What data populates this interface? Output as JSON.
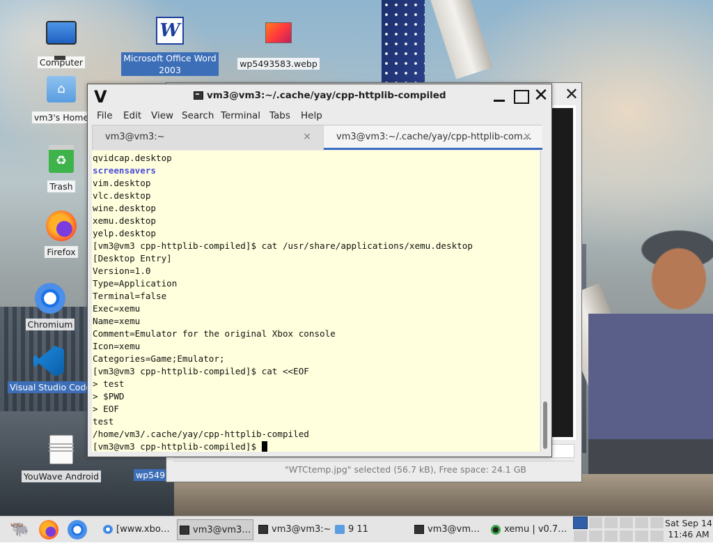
{
  "desktop": {
    "icons": [
      {
        "label": "Computer",
        "icon": "computer-icon"
      },
      {
        "label": "vm3's Home",
        "icon": "home-folder-icon"
      },
      {
        "label": "Trash",
        "icon": "trash-icon"
      },
      {
        "label": "Firefox",
        "icon": "firefox-icon"
      },
      {
        "label": "Chromium",
        "icon": "chromium-icon"
      },
      {
        "label": "Visual Studio Code",
        "icon": "vscode-icon"
      },
      {
        "label": "YouWave Android",
        "icon": "document-icon"
      },
      {
        "label": "Microsoft Office Word 2003",
        "icon": "word-icon"
      },
      {
        "label": "wp5493583.webp",
        "icon": "image-icon"
      },
      {
        "label": "wp549",
        "icon": "image-icon"
      }
    ]
  },
  "file_manager": {
    "status": "\"WTCtemp.jpg\" selected (56.7 kB), Free space: 24.1 GB",
    "close_glyph": "✕"
  },
  "terminal": {
    "app_logo": "V",
    "title": "vm3@vm3:~/.cache/yay/cpp-httplib-compiled",
    "close_glyph": "✕",
    "menu": [
      "File",
      "Edit",
      "View",
      "Search",
      "Terminal",
      "Tabs",
      "Help"
    ],
    "tabs": [
      {
        "label": "vm3@vm3:~",
        "close": "×",
        "active": false
      },
      {
        "label": "vm3@vm3:~/.cache/yay/cpp-httplib-com…",
        "close": "×",
        "active": true
      }
    ],
    "lines": [
      "qvidcap.desktop",
      "screensavers",
      "vim.desktop",
      "vlc.desktop",
      "wine.desktop",
      "xemu.desktop",
      "yelp.desktop",
      "[vm3@vm3 cpp-httplib-compiled]$ cat /usr/share/applications/xemu.desktop",
      "[Desktop Entry]",
      "Version=1.0",
      "Type=Application",
      "Terminal=false",
      "Exec=xemu",
      "Name=xemu",
      "Comment=Emulator for the original Xbox console",
      "Icon=xemu",
      "Categories=Game;Emulator;",
      "[vm3@vm3 cpp-httplib-compiled]$ cat <<EOF",
      "> test",
      "> $PWD",
      "> EOF",
      "test",
      "/home/vm3/.cache/yay/cpp-httplib-compiled",
      "[vm3@vm3 cpp-httplib-compiled]$ "
    ],
    "directory_line_index": 1,
    "colors": {
      "background": "#ffffdd",
      "directory": "#4d4dd9",
      "tab_accent": "#3a6bbf"
    }
  },
  "taskbar": {
    "launchers": [
      "gnu-icon",
      "firefox-icon",
      "chromium-icon"
    ],
    "tasks": [
      {
        "label": "[www.xbo…",
        "icon": "chromium-icon",
        "active": false
      },
      {
        "label": "vm3@vm3…",
        "icon": "terminal-icon",
        "active": true
      },
      {
        "label": "vm3@vm3:~",
        "icon": "terminal-icon",
        "active": false
      },
      {
        "label": "9 11",
        "icon": "folder-icon",
        "active": false
      },
      {
        "label": "vm3@vm…",
        "icon": "terminal-icon",
        "active": false
      },
      {
        "label": "xemu | v0.7…",
        "icon": "xemu-icon",
        "active": false
      }
    ],
    "pager_active_workspace": 1,
    "clock": {
      "date": "Sat Sep 14",
      "time": "11:46 AM"
    }
  }
}
